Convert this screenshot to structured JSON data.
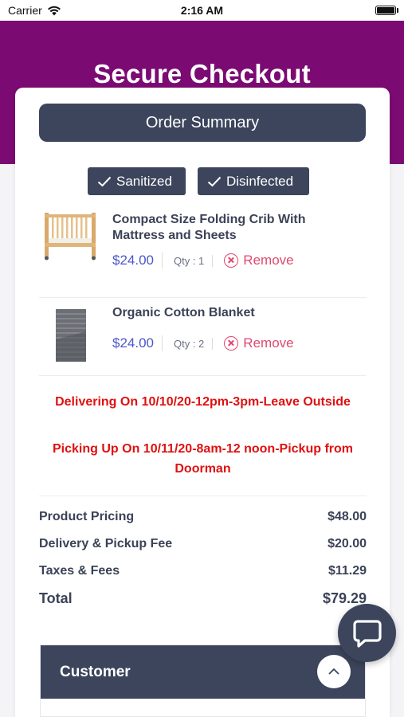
{
  "status_bar": {
    "carrier": "Carrier",
    "time": "2:16 AM"
  },
  "header": {
    "title": "Secure Checkout"
  },
  "order_summary": {
    "label": "Order Summary"
  },
  "badges": [
    {
      "label": "Sanitized",
      "icon": "check-icon"
    },
    {
      "label": "Disinfected",
      "icon": "check-icon"
    }
  ],
  "items": [
    {
      "name": "Compact Size Folding Crib With Mattress and Sheets",
      "price": "$24.00",
      "qty": "Qty : 1",
      "remove_label": "Remove",
      "thumb_icon": "crib-image"
    },
    {
      "name": "Organic Cotton Blanket",
      "price": "$24.00",
      "qty": "Qty : 2",
      "remove_label": "Remove",
      "thumb_icon": "blanket-image"
    }
  ],
  "notices": {
    "delivery": "Delivering On 10/10/20-12pm-3pm-Leave Outside",
    "pickup": "Picking Up On 10/11/20-8am-12 noon-Pickup from Doorman"
  },
  "totals": [
    {
      "label": "Product Pricing",
      "value": "$48.00"
    },
    {
      "label": "Delivery & Pickup Fee",
      "value": "$20.00"
    },
    {
      "label": "Taxes & Fees",
      "value": "$11.29"
    },
    {
      "label": "Total",
      "value": "$79.29"
    }
  ],
  "customer": {
    "title": "Customer"
  },
  "colors": {
    "brand": "#7b0a73",
    "panel": "#3c455c",
    "price": "#4a57c9",
    "remove": "#e0486e",
    "notice": "#e01010"
  }
}
